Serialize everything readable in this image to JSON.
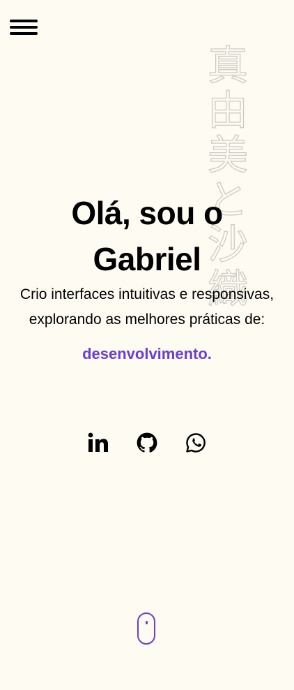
{
  "header": {
    "menu_icon": "hamburger-menu-icon"
  },
  "decor": {
    "kanji": [
      "真",
      "由",
      "美",
      "と",
      "沙",
      "織"
    ],
    "kanji_color": "#c8c6c0"
  },
  "hero": {
    "title": "Olá, sou o Gabriel",
    "subtitle": "Crio interfaces intuitivas e responsivas, explorando as melhores práticas de:",
    "highlight": "desenvolvimento.",
    "highlight_color": "#6a3fd0"
  },
  "social": {
    "items": [
      {
        "icon": "linkedin-icon"
      },
      {
        "icon": "github-icon"
      },
      {
        "icon": "whatsapp-icon"
      }
    ]
  },
  "scroll": {
    "icon": "mouse-scroll-icon",
    "color": "#6a3fd0"
  },
  "colors": {
    "background": "#fefbf3",
    "text": "#000000",
    "accent": "#6a3fd0"
  }
}
